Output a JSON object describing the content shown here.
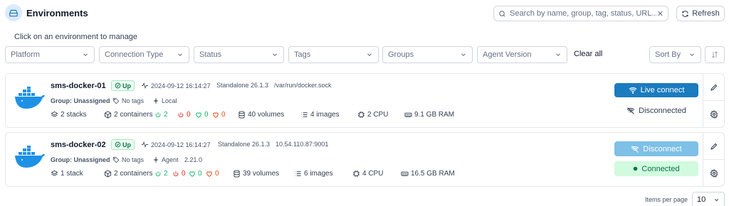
{
  "header": {
    "title": "Environments",
    "search_placeholder": "Search by name, group, tag, status, URL...",
    "refresh_label": "Refresh"
  },
  "subtitle": "Click on an environment to manage",
  "filters": {
    "platform": "Platform",
    "connection_type": "Connection Type",
    "status": "Status",
    "tags": "Tags",
    "groups": "Groups",
    "agent_version": "Agent Version",
    "clear_all": "Clear all",
    "sort_by": "Sort By"
  },
  "environments": [
    {
      "name": "sms-docker-01",
      "status": "Up",
      "timestamp": "2024-09-12 16:14:27",
      "engine": "Standalone 26.1.3",
      "url": "/var/run/docker.sock",
      "group": "Group: Unassigned",
      "tags": "No tags",
      "connection": "Local",
      "agent_version": "",
      "stacks": "2 stacks",
      "containers": "2 containers",
      "running": "2",
      "stopped": "0",
      "healthy": "0",
      "unhealthy": "0",
      "volumes": "40 volumes",
      "images": "4 images",
      "cpu": "2 CPU",
      "ram": "9.1 GB RAM",
      "primary_action": "Live connect",
      "secondary_status": "Disconnected"
    },
    {
      "name": "sms-docker-02",
      "status": "Up",
      "timestamp": "2024-09-12 16:14:27",
      "engine": "Standalone 26.1.3",
      "url": "10.54.110.87:9001",
      "group": "Group: Unassigned",
      "tags": "No tags",
      "connection": "Agent",
      "agent_version": "2.21.0",
      "stacks": "1 stack",
      "containers": "2 containers",
      "running": "2",
      "stopped": "0",
      "healthy": "0",
      "unhealthy": "0",
      "volumes": "39 volumes",
      "images": "6 images",
      "cpu": "4 CPU",
      "ram": "16.5 GB RAM",
      "primary_action": "Disconnect",
      "secondary_status": "Connected"
    }
  ],
  "footer": {
    "items_per_page_label": "Items per page",
    "items_per_page_value": "10"
  },
  "colors": {
    "accent": "#1a7bbf",
    "up_badge": "#067647",
    "docker_blue": "#1d91e6",
    "connected_bg": "#d1fadf"
  }
}
